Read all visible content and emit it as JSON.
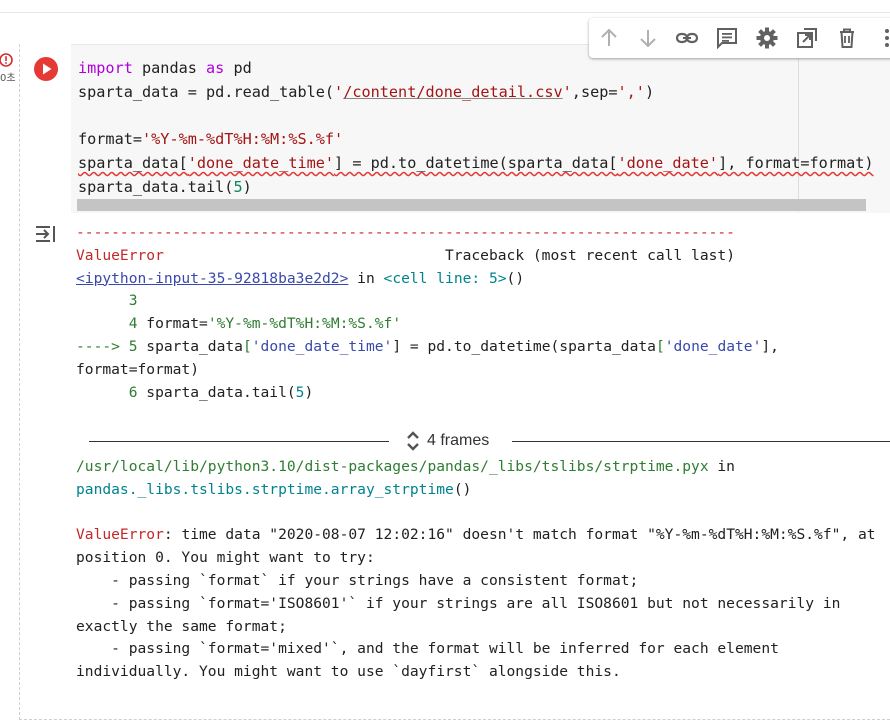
{
  "cell": {
    "error_time": "0초",
    "code_lines": [
      [
        {
          "t": "import",
          "c": "kw"
        },
        {
          "t": " pandas "
        },
        {
          "t": "as",
          "c": "kw"
        },
        {
          "t": " pd"
        }
      ],
      [
        {
          "t": "sparta_data = pd.read_table("
        },
        {
          "t": "'",
          "c": "str"
        },
        {
          "t": "/content/done_detail.csv",
          "c": "str gline"
        },
        {
          "t": "'",
          "c": "str"
        },
        {
          "t": ",sep="
        },
        {
          "t": "','",
          "c": "str"
        },
        {
          "t": ")"
        }
      ],
      [],
      [
        {
          "t": "format="
        },
        {
          "t": "'%Y-%m-%dT%H:%M:%S.%f'",
          "c": "str"
        }
      ],
      [
        {
          "t": "sparta_data[",
          "c": "squig"
        },
        {
          "t": "'done_date_time'",
          "c": "str squig"
        },
        {
          "t": "] = pd.to_datetime(sparta_data[",
          "c": "squig"
        },
        {
          "t": "'done_date'",
          "c": "str squig"
        },
        {
          "t": "], format=format)",
          "c": "squig"
        }
      ],
      [
        {
          "t": "sparta_data.tail("
        },
        {
          "t": "5",
          "c": "num"
        },
        {
          "t": ")"
        }
      ]
    ]
  },
  "traceback": {
    "lines": [
      [
        {
          "t": "---------------------------------------------------------------------------",
          "c": "red"
        }
      ],
      [
        {
          "t": "ValueError",
          "c": "red"
        },
        {
          "t": "                                Traceback (most recent call last)"
        }
      ],
      [
        {
          "t": "<ipython-input-35-92818ba3e2d2>",
          "c": "link"
        },
        {
          "t": " in "
        },
        {
          "t": "<cell line: 5>",
          "c": "teal"
        },
        {
          "t": "()"
        }
      ],
      [
        {
          "t": "      "
        },
        {
          "t": "3",
          "c": "green"
        }
      ],
      [
        {
          "t": "      "
        },
        {
          "t": "4",
          "c": "green"
        },
        {
          "t": " format="
        },
        {
          "t": "'%Y-%m-%dT%H:%M:%S.%f'",
          "c": "green"
        }
      ],
      [
        {
          "t": "----> 5",
          "c": "green"
        },
        {
          "t": " sparta_data"
        },
        {
          "t": "[",
          "c": "green"
        },
        {
          "t": "'done_date_time'",
          "c": "blue"
        },
        {
          "t": "] = pd.to_datetime(sparta_data"
        },
        {
          "t": "[",
          "c": "green"
        },
        {
          "t": "'done_date'",
          "c": "blue"
        },
        {
          "t": "],"
        }
      ],
      [
        {
          "t": "format=format)"
        }
      ],
      [
        {
          "t": "      "
        },
        {
          "t": "6",
          "c": "green"
        },
        {
          "t": " sparta_data.tail("
        },
        {
          "t": "5",
          "c": "teal"
        },
        {
          "t": ")"
        }
      ]
    ],
    "frames_label": "4 frames",
    "lines2": [
      [
        {
          "t": "/usr/local/lib/python3.10/dist-packages/pandas/_libs/tslibs/strptime.pyx",
          "c": "green"
        },
        {
          "t": " in"
        }
      ],
      [
        {
          "t": "pandas._libs.tslibs.strptime.array_strptime",
          "c": "teal"
        },
        {
          "t": "()"
        }
      ],
      [],
      [
        {
          "t": "ValueError",
          "c": "red"
        },
        {
          "t": ": time data \"2020-08-07 12:02:16\" doesn't match format \"%Y-%m-%dT%H:%M:%S.%f\", at"
        }
      ],
      [
        {
          "t": "position 0. You might want to try:"
        }
      ],
      [
        {
          "t": "    - passing `format` if your strings have a consistent format;"
        }
      ],
      [
        {
          "t": "    - passing `format='ISO8601'` if your strings are all ISO8601 but not necessarily in"
        }
      ],
      [
        {
          "t": "exactly the same format;"
        }
      ],
      [
        {
          "t": "    - passing `format='mixed'`, and the format will be inferred for each element"
        }
      ],
      [
        {
          "t": "individually. You might want to use `dayfirst` alongside this."
        }
      ]
    ]
  },
  "toolbar": {
    "icons": [
      "arrow-up-icon",
      "arrow-down-icon",
      "link-icon",
      "comment-icon",
      "gear-icon",
      "mirror-cell-icon",
      "trash-icon",
      "more-vert-icon"
    ]
  },
  "colors": {
    "run_button": "#e53935",
    "error_icon": "#d32f2f",
    "toolbar_icon": "#616161",
    "toolbar_icon_disabled": "#b0b0b0"
  }
}
